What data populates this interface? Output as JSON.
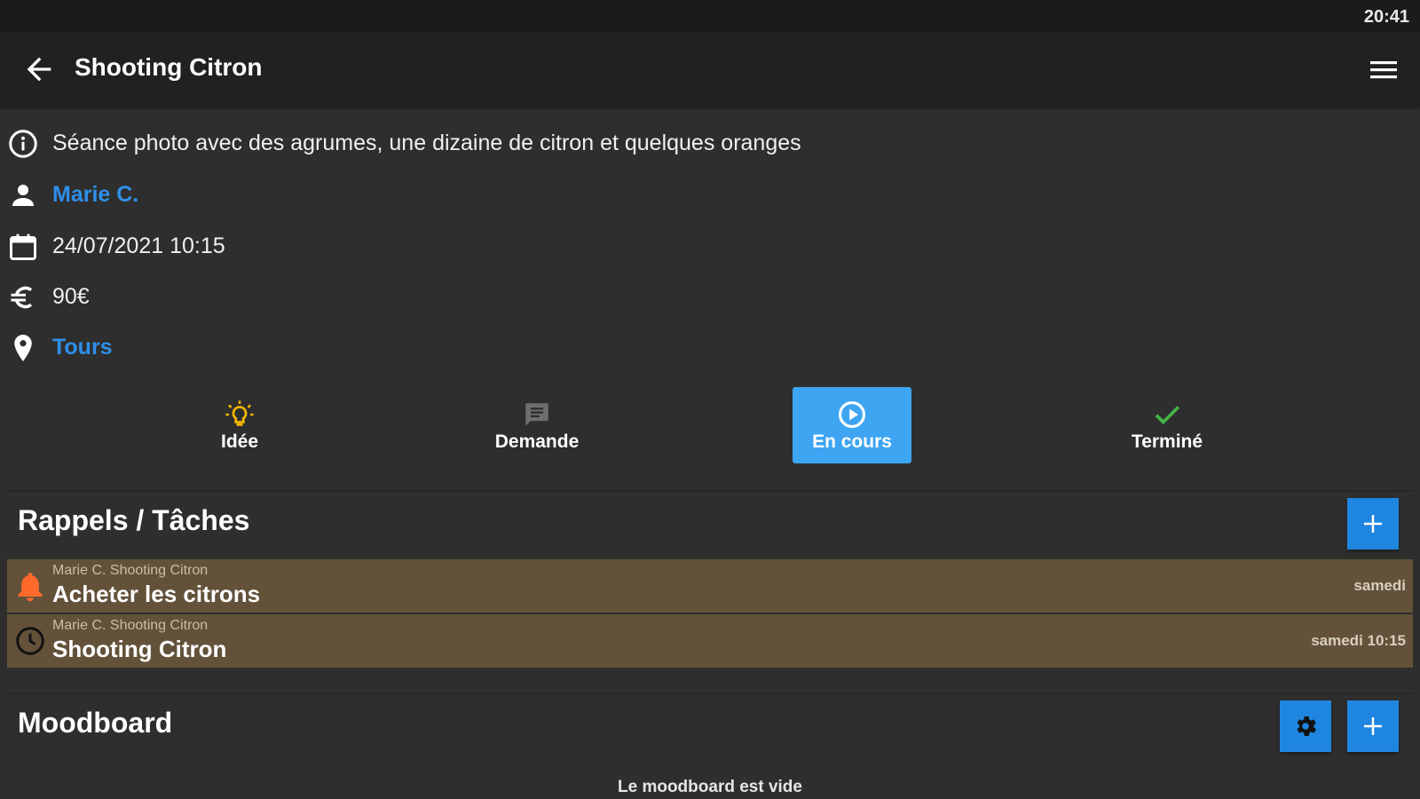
{
  "status_bar": {
    "time": "20:41"
  },
  "app_bar": {
    "title": "Shooting Citron"
  },
  "details": {
    "description": "Séance photo avec des agrumes, une dizaine de citron et quelques oranges",
    "client": "Marie C.",
    "datetime": "24/07/2021 10:15",
    "price": "90€",
    "location": "Tours"
  },
  "status_steps": [
    {
      "label": "Idée",
      "icon": "lightbulb-icon"
    },
    {
      "label": "Demande",
      "icon": "message-icon"
    },
    {
      "label": "En cours",
      "icon": "play-circle-icon",
      "active": true
    },
    {
      "label": "Terminé",
      "icon": "check-icon"
    }
  ],
  "tasks_section": {
    "title": "Rappels / Tâches",
    "items": [
      {
        "meta": "Marie C.  Shooting Citron",
        "name": "Acheter les citrons",
        "date": "samedi",
        "icon": "bell-icon"
      },
      {
        "meta": "Marie C.  Shooting Citron",
        "name": "Shooting Citron",
        "date": "samedi 10:15",
        "icon": "clock-icon"
      }
    ]
  },
  "moodboard_section": {
    "title": "Moodboard",
    "empty_text": "Le moodboard est vide"
  },
  "colors": {
    "background": "#2e2e2e",
    "app_bar": "#212121",
    "link": "#2f8fe8",
    "active_status": "#3ea5f2",
    "button": "#1f86e0",
    "task_row": "#63513a",
    "idea_icon": "#f2b600",
    "done_icon": "#43b649",
    "alarm_icon": "#ff6a2a"
  }
}
